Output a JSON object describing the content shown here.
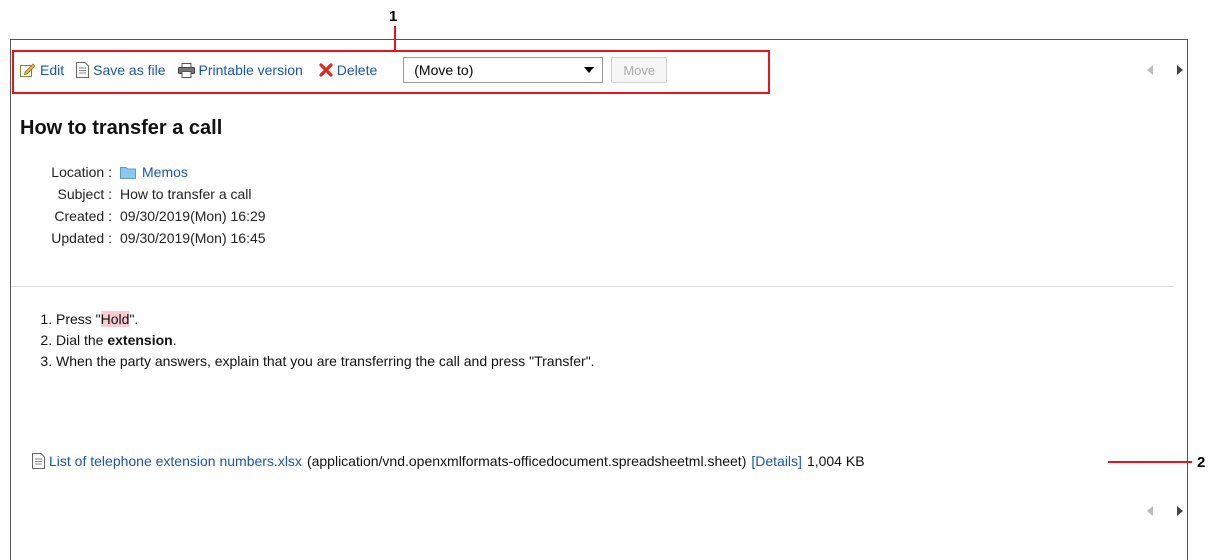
{
  "callouts": [
    "1",
    "2"
  ],
  "toolbar": {
    "edit_label": "Edit",
    "save_label": "Save as file",
    "print_label": "Printable version",
    "delete_label": "Delete",
    "move_select_value": "(Move to)",
    "move_button_label": "Move"
  },
  "memo": {
    "title": "How to transfer a call",
    "meta": [
      {
        "label": "Location :",
        "value": "Memos"
      },
      {
        "label": "Subject :",
        "value": "How to transfer a call"
      },
      {
        "label": "Created :",
        "value": "09/30/2019(Mon) 16:29"
      },
      {
        "label": "Updated :",
        "value": "09/30/2019(Mon) 16:45"
      }
    ],
    "steps": [
      {
        "pre": "Press \"",
        "hl": "Hold",
        "post": "\"."
      },
      {
        "pre": "Dial the ",
        "bold": "extension",
        "post": "."
      },
      {
        "text": "When the party answers, explain that you are transferring the call and press \"Transfer\"."
      }
    ],
    "attachment": {
      "file_name": "List of telephone extension numbers.xlsx",
      "mime": "(application/vnd.openxmlformats-officedocument.spreadsheetml.sheet)",
      "details_label": "[Details]",
      "size": "1,004 KB"
    }
  },
  "colors": {
    "link": "#1a55b5",
    "accent_red": "#e8131b",
    "highlight": "#f8cccc"
  },
  "icons": [
    "edit-icon",
    "file-icon",
    "printer-icon",
    "delete-x-icon",
    "folder-icon",
    "chevron-left-icon",
    "chevron-right-icon"
  ]
}
